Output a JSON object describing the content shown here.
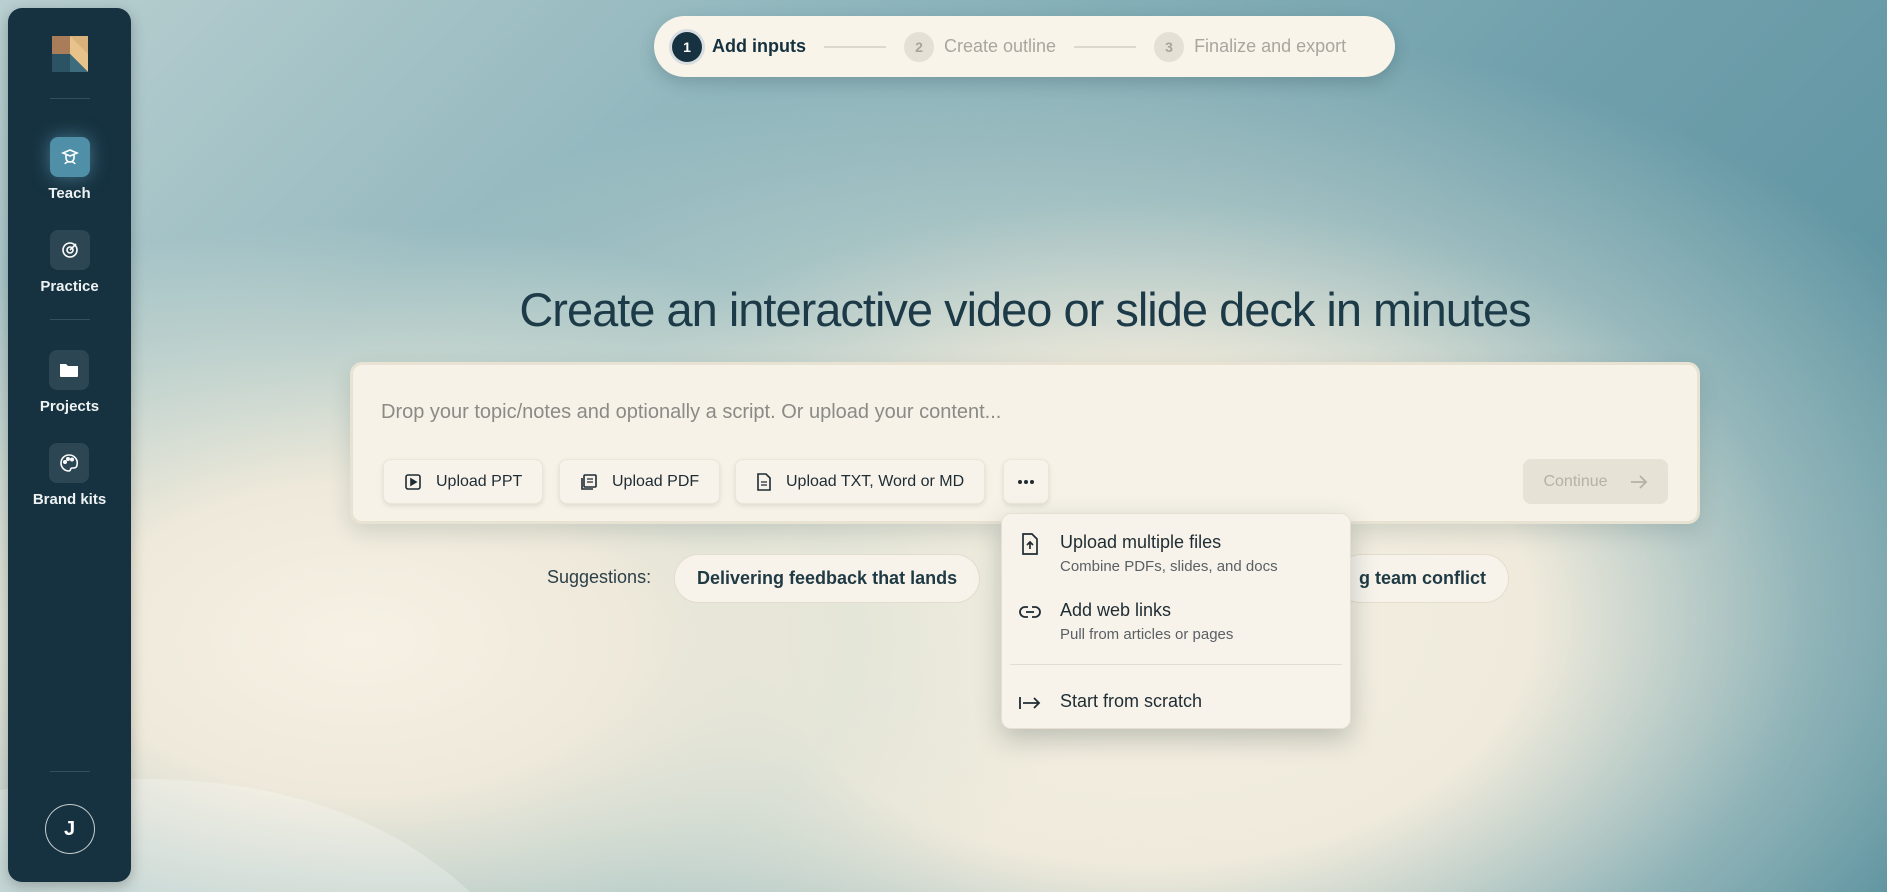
{
  "sidebar": {
    "items": [
      {
        "label": "Teach",
        "icon": "teach-icon",
        "active": true
      },
      {
        "label": "Practice",
        "icon": "target-icon",
        "active": false
      },
      {
        "label": "Projects",
        "icon": "folder-icon",
        "active": false
      },
      {
        "label": "Brand kits",
        "icon": "palette-icon",
        "active": false
      }
    ],
    "avatar_initial": "J"
  },
  "stepper": {
    "steps": [
      {
        "num": "1",
        "label": "Add inputs",
        "active": true
      },
      {
        "num": "2",
        "label": "Create outline",
        "active": false
      },
      {
        "num": "3",
        "label": "Finalize and export",
        "active": false
      }
    ]
  },
  "main": {
    "headline": "Create an interactive video or slide deck in minutes",
    "input_placeholder": "Drop your topic/notes and optionally a script. Or upload your content...",
    "buttons": {
      "upload_ppt": "Upload PPT",
      "upload_pdf": "Upload PDF",
      "upload_txt": "Upload TXT, Word or MD",
      "continue": "Continue"
    },
    "suggestions_label": "Suggestions:",
    "suggestions": [
      "Delivering feedback that lands",
      "g team conflict"
    ]
  },
  "dropdown": {
    "items": [
      {
        "title": "Upload multiple files",
        "subtitle": "Combine PDFs, slides, and docs"
      },
      {
        "title": "Add web links",
        "subtitle": "Pull from articles or pages"
      },
      {
        "title": "Start from scratch"
      }
    ]
  },
  "colors": {
    "sidebar_bg": "#163240",
    "accent": "#4f8fa8",
    "surface": "#f7f3ea"
  }
}
